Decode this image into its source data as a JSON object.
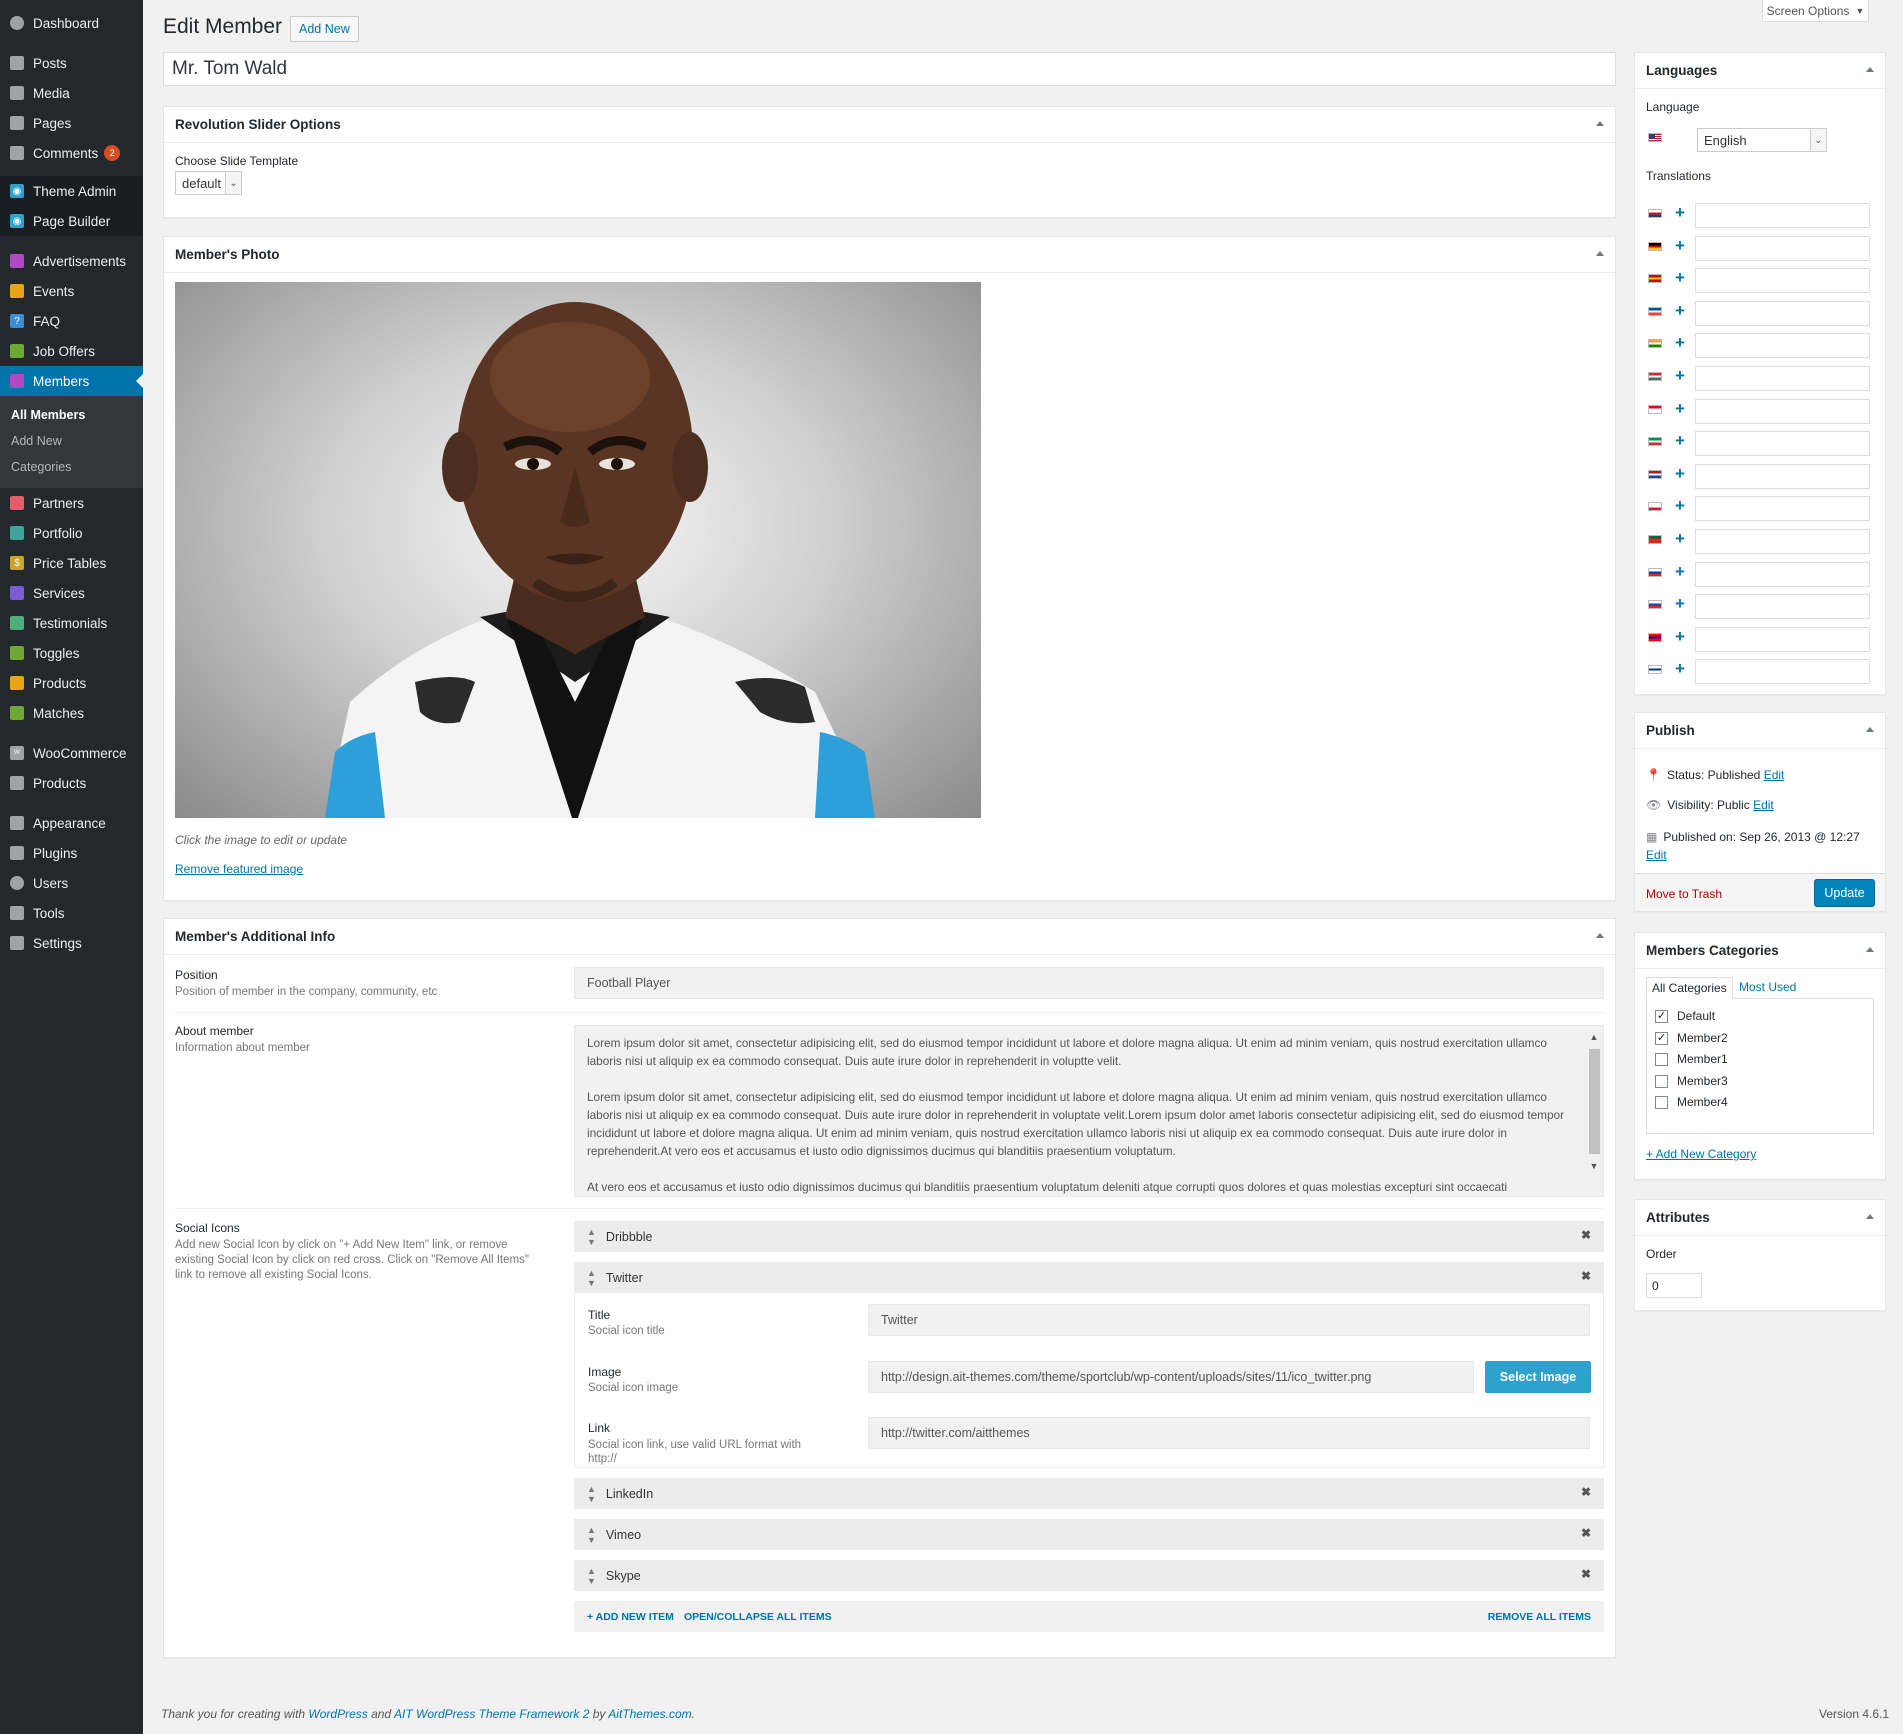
{
  "sidebar": {
    "items": [
      {
        "label": "Dashboard",
        "icon": "dashboard-icon"
      },
      {
        "label": "Posts",
        "icon": "pin-icon"
      },
      {
        "label": "Media",
        "icon": "media-icon"
      },
      {
        "label": "Pages",
        "icon": "pages-icon"
      },
      {
        "label": "Comments",
        "icon": "comment-icon",
        "badge": "2"
      },
      {
        "label": "Theme Admin",
        "icon": "theme-admin-icon"
      },
      {
        "label": "Page Builder",
        "icon": "page-builder-icon"
      },
      {
        "label": "Advertisements",
        "icon": "ads-icon"
      },
      {
        "label": "Events",
        "icon": "events-icon"
      },
      {
        "label": "FAQ",
        "icon": "faq-icon"
      },
      {
        "label": "Job Offers",
        "icon": "job-icon"
      },
      {
        "label": "Members",
        "icon": "members-icon"
      },
      {
        "label": "Partners",
        "icon": "partners-icon"
      },
      {
        "label": "Portfolio",
        "icon": "portfolio-icon"
      },
      {
        "label": "Price Tables",
        "icon": "price-icon"
      },
      {
        "label": "Services",
        "icon": "services-icon"
      },
      {
        "label": "Testimonials",
        "icon": "testimonials-icon"
      },
      {
        "label": "Toggles",
        "icon": "toggles-icon"
      },
      {
        "label": "Products",
        "icon": "products-icon"
      },
      {
        "label": "Matches",
        "icon": "matches-icon"
      },
      {
        "label": "WooCommerce",
        "icon": "woocommerce-icon"
      },
      {
        "label": "Products",
        "icon": "box-icon"
      },
      {
        "label": "Appearance",
        "icon": "brush-icon"
      },
      {
        "label": "Plugins",
        "icon": "plugin-icon"
      },
      {
        "label": "Users",
        "icon": "users-icon"
      },
      {
        "label": "Tools",
        "icon": "tools-icon"
      },
      {
        "label": "Settings",
        "icon": "settings-icon"
      }
    ],
    "submenu": [
      "All Members",
      "Add New",
      "Categories"
    ]
  },
  "header": {
    "title": "Edit Member",
    "add_new": "Add New",
    "screen_options": "Screen Options"
  },
  "post_title": "Mr. Tom Wald",
  "revslider": {
    "title": "Revolution Slider Options",
    "label": "Choose Slide Template",
    "value": "default"
  },
  "photo": {
    "title": "Member's Photo",
    "hint": "Click the image to edit or update",
    "remove": "Remove featured image"
  },
  "info": {
    "title": "Member's Additional Info",
    "position": {
      "label": "Position",
      "desc": "Position of member in the company, community, etc",
      "value": "Football Player"
    },
    "about": {
      "label": "About member",
      "desc": "Information about member",
      "p1": "Lorem ipsum dolor sit amet, consectetur adipisicing elit, sed do eiusmod tempor incididunt ut labore et dolore magna aliqua. Ut enim ad minim veniam, quis nostrud exercitation ullamco laboris nisi ut aliquip ex ea commodo consequat. Duis aute irure dolor in reprehenderit in voluptte velit.",
      "p2": "Lorem ipsum dolor sit amet, consectetur adipisicing elit, sed do eiusmod tempor incididunt ut labore et dolore magna aliqua. Ut enim ad minim veniam, quis nostrud exercitation ullamco laboris nisi ut aliquip ex ea commodo consequat. Duis aute irure dolor in reprehenderit in voluptate velit.Lorem ipsum dolor amet laboris consectetur adipisicing elit, sed do eiusmod tempor incididunt ut labore et dolore magna aliqua. Ut enim ad minim veniam, quis nostrud exercitation ullamco laboris nisi ut aliquip ex ea commodo consequat. Duis aute irure dolor in reprehenderit.At vero eos et accusamus et iusto odio dignissimos ducimus qui blanditiis praesentium voluptatum.",
      "p3": "At vero eos et accusamus et iusto odio dignissimos ducimus qui blanditiis praesentium voluptatum deleniti atque corrupti quos dolores et quas molestias excepturi sint occaecati"
    },
    "social": {
      "label": "Social Icons",
      "desc": "Add new Social Icon by click on \"+ Add New Item\" link, or remove existing Social Icon by click on red cross. Click on \"Remove All Items\" link to remove all existing Social Icons.",
      "items": [
        "Dribbble",
        "Twitter",
        "LinkedIn",
        "Vimeo",
        "Skype"
      ],
      "expanded": {
        "title_label": "Title",
        "title_desc": "Social icon title",
        "title_value": "Twitter",
        "image_label": "Image",
        "image_desc": "Social icon image",
        "image_value": "http://design.ait-themes.com/theme/sportclub/wp-content/uploads/sites/11/ico_twitter.png",
        "select_image": "Select Image",
        "link_label": "Link",
        "link_desc": "Social icon link, use valid URL format with http://",
        "link_value": "http://twitter.com/aitthemes"
      },
      "add_new": "+ ADD NEW ITEM",
      "open_collapse": "OPEN/COLLAPSE ALL ITEMS",
      "remove_all": "REMOVE ALL ITEMS"
    }
  },
  "languages": {
    "title": "Languages",
    "language_label": "Language",
    "language_value": "English",
    "translations_label": "Translations",
    "flags": [
      {
        "name": "cs",
        "colors": [
          "#ffffff",
          "#d7141a",
          "#11457e"
        ]
      },
      {
        "name": "de",
        "colors": [
          "#000000",
          "#dd0000",
          "#ffce00"
        ]
      },
      {
        "name": "es",
        "colors": [
          "#c60b1e",
          "#ffc400",
          "#c60b1e"
        ]
      },
      {
        "name": "fr",
        "colors": [
          "#0055a4",
          "#ffffff",
          "#ef4135"
        ]
      },
      {
        "name": "hi",
        "colors": [
          "#ff9933",
          "#ffffff",
          "#138808"
        ]
      },
      {
        "name": "hu",
        "colors": [
          "#ce2939",
          "#ffffff",
          "#477050"
        ]
      },
      {
        "name": "id",
        "colors": [
          "#ce1126",
          "#ffffff",
          "#ffffff"
        ]
      },
      {
        "name": "it",
        "colors": [
          "#009246",
          "#ffffff",
          "#ce2b37"
        ]
      },
      {
        "name": "nl",
        "colors": [
          "#ae1c28",
          "#ffffff",
          "#21468b"
        ]
      },
      {
        "name": "pl",
        "colors": [
          "#ffffff",
          "#ffffff",
          "#dc143c"
        ]
      },
      {
        "name": "pt",
        "colors": [
          "#046a38",
          "#da291c",
          "#da291c"
        ]
      },
      {
        "name": "ru",
        "colors": [
          "#ffffff",
          "#0039a6",
          "#d52b1e"
        ]
      },
      {
        "name": "sk",
        "colors": [
          "#ffffff",
          "#0b4ea2",
          "#ee1c25"
        ]
      },
      {
        "name": "tw",
        "colors": [
          "#fe0000",
          "#000095",
          "#fe0000"
        ]
      },
      {
        "name": "fi",
        "colors": [
          "#ffffff",
          "#003580",
          "#ffffff"
        ]
      }
    ]
  },
  "publish": {
    "title": "Publish",
    "status": "Status: Published",
    "visibility": "Visibility: Public",
    "published_on": "Published on: Sep 26, 2013 @ 12:27",
    "edit": "Edit",
    "trash": "Move to Trash",
    "update": "Update"
  },
  "categories": {
    "title": "Members Categories",
    "tab_all": "All Categories",
    "tab_most": "Most Used",
    "items": [
      {
        "label": "Default",
        "checked": true
      },
      {
        "label": "Member2",
        "checked": true
      },
      {
        "label": "Member1",
        "checked": false
      },
      {
        "label": "Member3",
        "checked": false
      },
      {
        "label": "Member4",
        "checked": false
      }
    ],
    "add_new": "+ Add New Category"
  },
  "attributes": {
    "title": "Attributes",
    "order_label": "Order",
    "order_value": "0"
  },
  "footer": {
    "prefix": "Thank you for creating with ",
    "wp": "WordPress",
    "and": " and ",
    "ait": "AIT WordPress Theme Framework 2",
    "by": " by ",
    "aitthemes": "AitThemes.com",
    "end": ".",
    "version": "Version 4.6.1"
  },
  "colors": {
    "accent": "#0073aa",
    "sidebar_bg": "#23282d",
    "select_image": "#2ea2cc",
    "trash": "#a00000"
  }
}
